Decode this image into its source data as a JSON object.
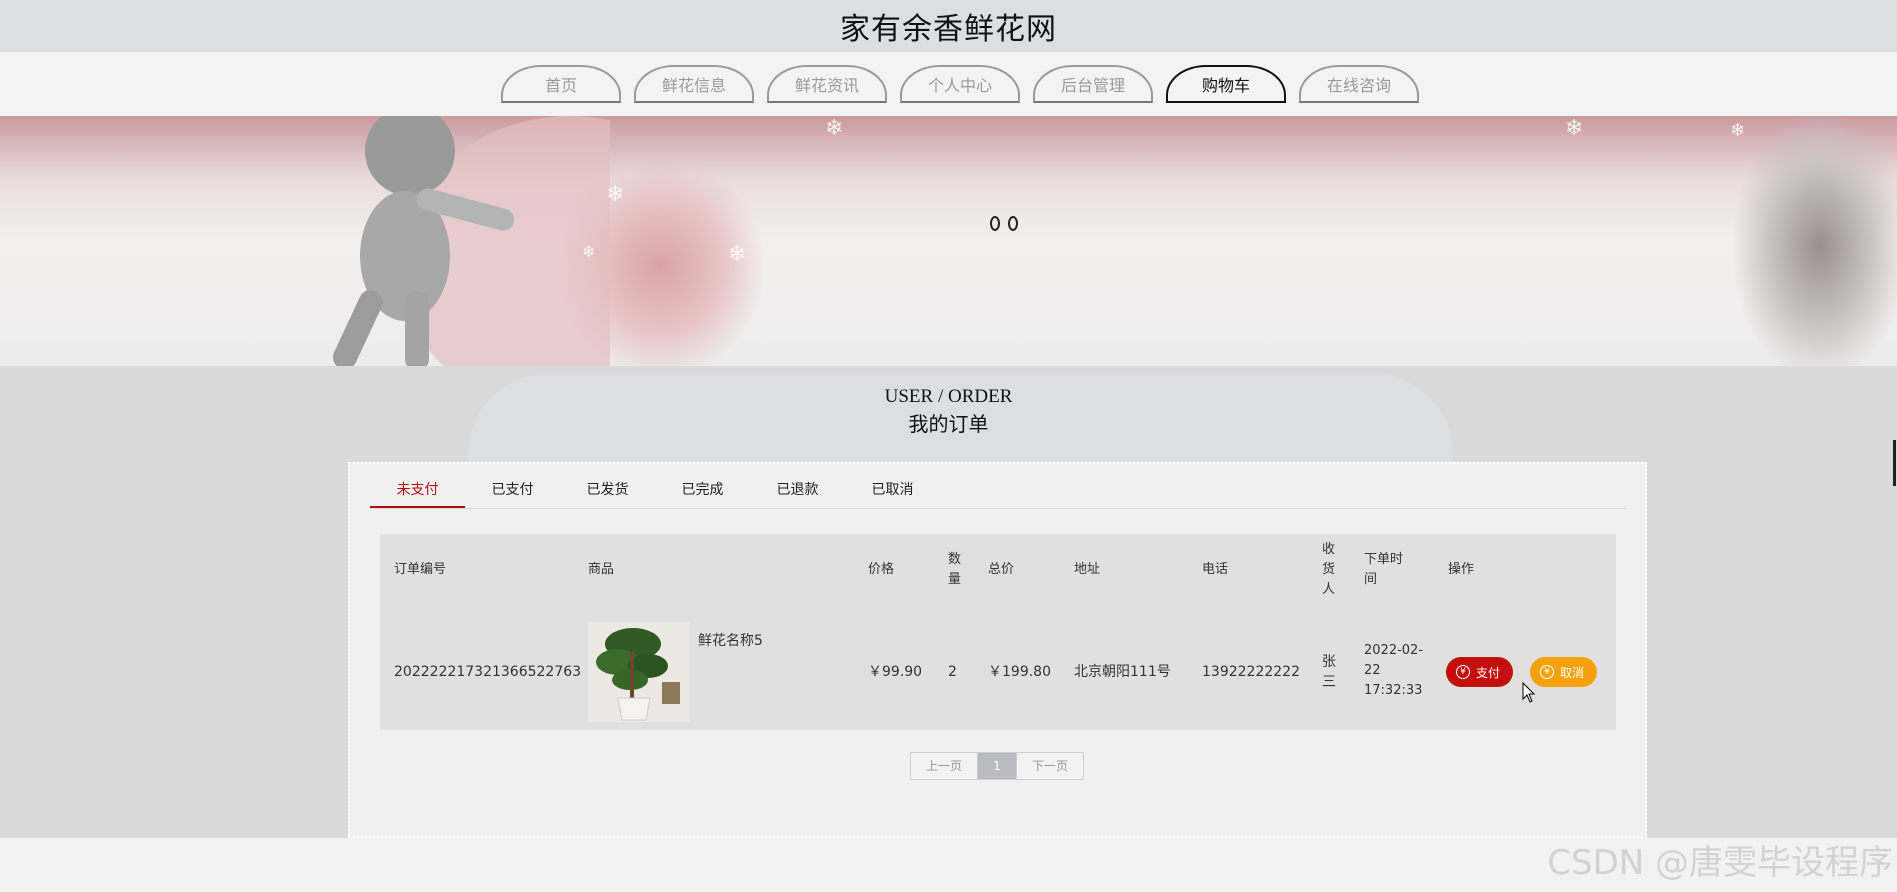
{
  "site": {
    "title": "家有余香鲜花网"
  },
  "nav": {
    "items": [
      {
        "label": "首页",
        "active": false
      },
      {
        "label": "鲜花信息",
        "active": false
      },
      {
        "label": "鲜花资讯",
        "active": false
      },
      {
        "label": "个人中心",
        "active": false
      },
      {
        "label": "后台管理",
        "active": false
      },
      {
        "label": "购物车",
        "active": true
      },
      {
        "label": "在线咨询",
        "active": false
      }
    ]
  },
  "section": {
    "title_en": "USER / ORDER",
    "title_zh": "我的订单"
  },
  "order_tabs": [
    {
      "label": "未支付",
      "active": true
    },
    {
      "label": "已支付",
      "active": false
    },
    {
      "label": "已发货",
      "active": false
    },
    {
      "label": "已完成",
      "active": false
    },
    {
      "label": "已退款",
      "active": false
    },
    {
      "label": "已取消",
      "active": false
    }
  ],
  "table": {
    "headers": {
      "order_no": "订单编号",
      "product": "商品",
      "price": "价格",
      "qty": "数量",
      "total": "总价",
      "address": "地址",
      "phone": "电话",
      "receiver": "收货人",
      "time": "下单时间",
      "ops": "操作"
    },
    "rows": [
      {
        "order_no": "202222217321366522763",
        "product_name": "鲜花名称5",
        "price": "￥99.90",
        "qty": "2",
        "total": "￥199.80",
        "address": "北京朝阳111号",
        "phone": "13922222222",
        "receiver": "张三",
        "time": "2022-02-22 17:32:33",
        "pay_label": "支付",
        "cancel_label": "取消"
      }
    ]
  },
  "pagination": {
    "prev": "上一页",
    "current": "1",
    "next": "下一页"
  },
  "watermark": "CSDN @唐雯毕设程序",
  "colors": {
    "accent_red": "#c40f0f",
    "accent_orange": "#f4a10c",
    "tab_active": "#b00d0d"
  }
}
